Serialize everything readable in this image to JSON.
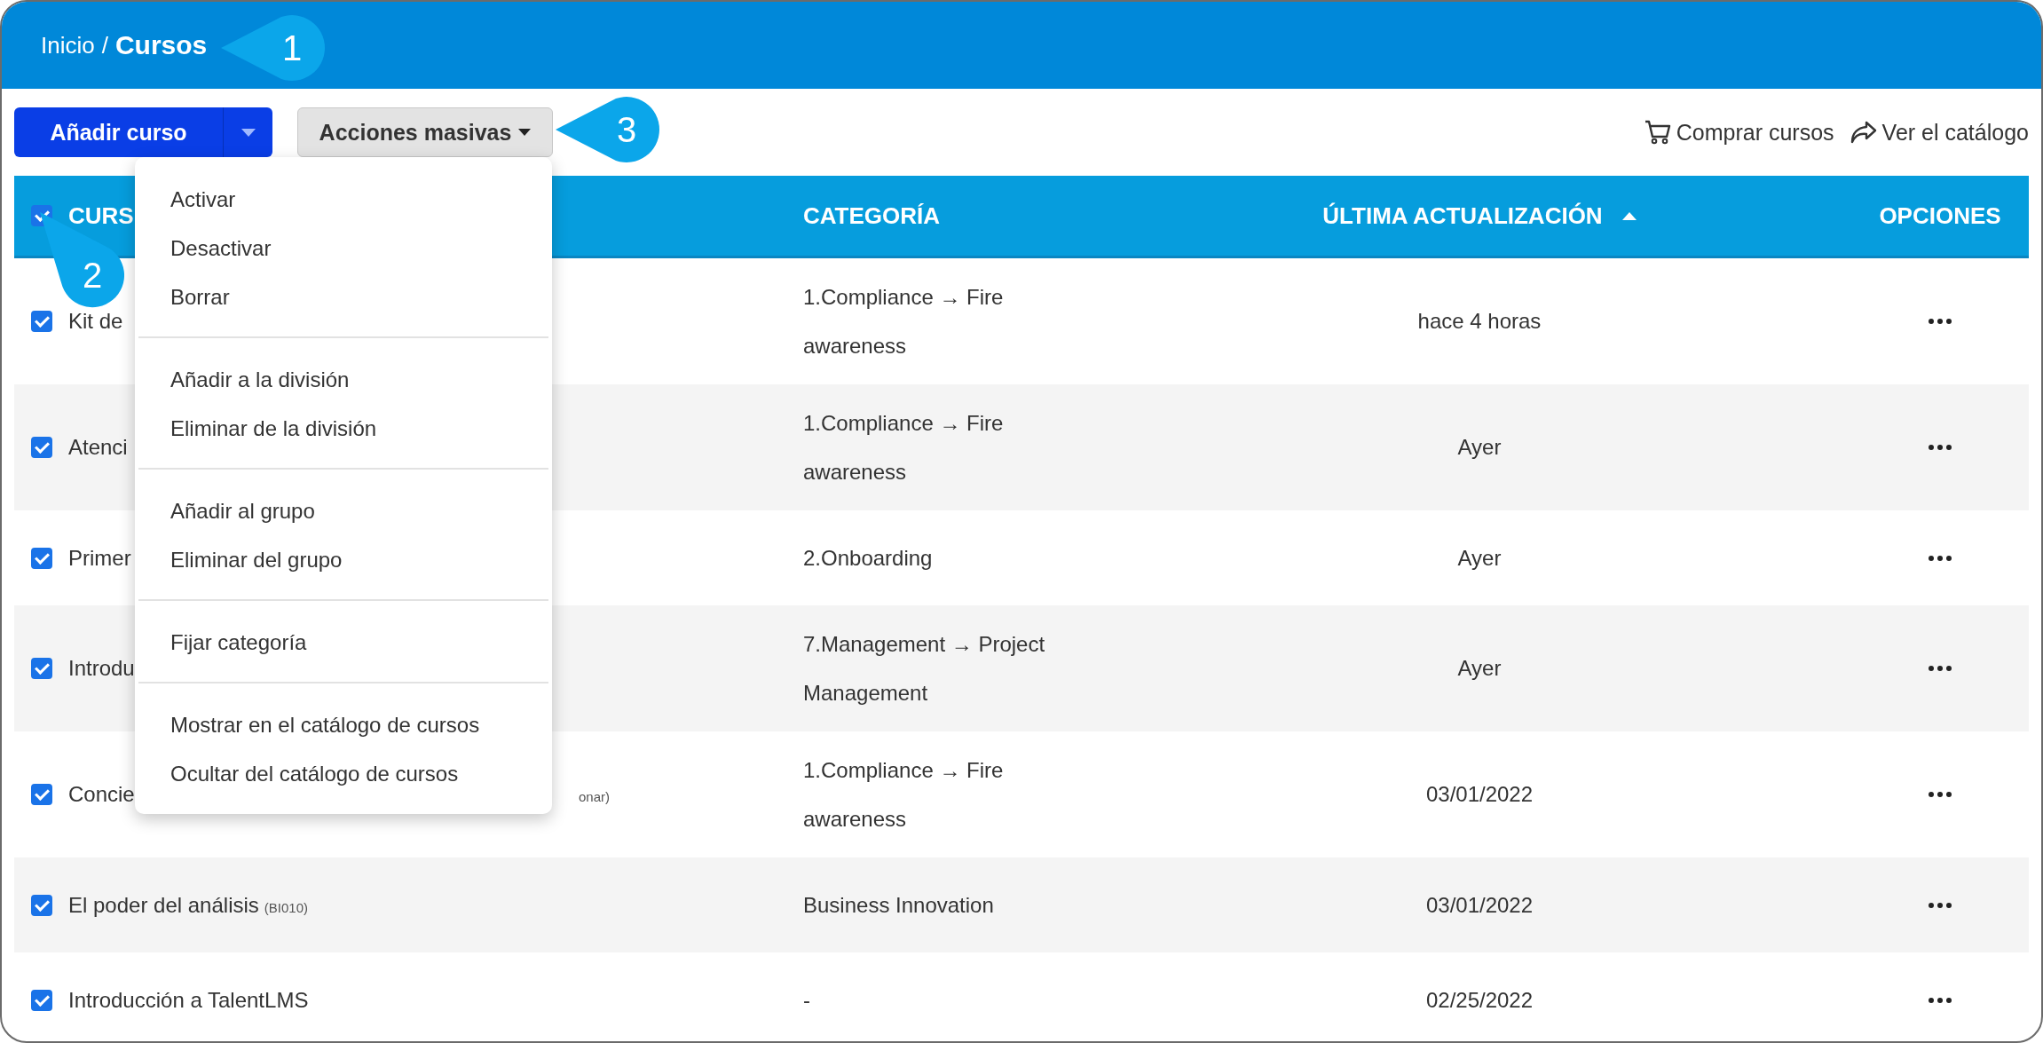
{
  "breadcrumb": [
    {
      "label": "Inicio",
      "current": false,
      "separator": "/"
    },
    {
      "label": "Cursos",
      "current": true
    }
  ],
  "toolbar": {
    "add_button": "Añadir curso",
    "bulk_button": "Acciones masivas",
    "links": [
      {
        "label": "Comprar cursos",
        "kind": "cart"
      },
      {
        "label": "Ver el catálogo",
        "kind": "share"
      }
    ]
  },
  "bulk_menu": {
    "groups": [
      {
        "items": [
          "Activar",
          "Desactivar",
          "Borrar"
        ]
      },
      {
        "items": [
          "Añadir a la división",
          "Eliminar de la división"
        ]
      },
      {
        "items": [
          "Añadir al grupo",
          "Eliminar del grupo"
        ]
      },
      {
        "items": [
          "Fijar categoría"
        ]
      },
      {
        "items": [
          "Mostrar en el catálogo de cursos",
          "Ocultar del catálogo de cursos"
        ]
      }
    ]
  },
  "table": {
    "select_all": {
      "checked": true
    },
    "columns": [
      {
        "label": "CURS"
      },
      {
        "label": "CATEGORÍA",
        "sorted": false
      },
      {
        "label": "ÚLTIMA ACTUALIZACIÓN",
        "sorted": true
      },
      {
        "label": "OPCIONES",
        "sorted": false
      }
    ],
    "rows": [
      {
        "checked": true,
        "course": {
          "kind": "plain",
          "name": "Kit de"
        },
        "category": "1.Compliance → Fire awareness",
        "updated": "hace 4 horas"
      },
      {
        "checked": true,
        "course": {
          "kind": "plain",
          "name": "Atenci"
        },
        "category": "1.Compliance → Fire awareness",
        "updated": "Ayer"
      },
      {
        "checked": true,
        "course": {
          "kind": "plain",
          "name": "Primer"
        },
        "category": "2.Onboarding",
        "updated": "Ayer"
      },
      {
        "checked": true,
        "course": {
          "kind": "plain",
          "name": "Introdu"
        },
        "category": "7.Management → Project Management",
        "updated": "Ayer"
      },
      {
        "checked": true,
        "course": {
          "kind": "partly_hidden",
          "name": "Concie",
          "code": "onar)"
        },
        "category": "1.Compliance → Fire awareness",
        "updated": "03/01/2022"
      },
      {
        "checked": true,
        "course": {
          "kind": "plain",
          "name": "El poder del análisis",
          "code": "(BI010)"
        },
        "category": "Business Innovation",
        "updated": "03/01/2022"
      },
      {
        "checked": true,
        "course": {
          "kind": "plain",
          "name": "Introducción a TalentLMS"
        },
        "category": "-",
        "updated": "02/25/2022"
      }
    ]
  },
  "callouts": [
    {
      "number": "1",
      "kind": "left"
    },
    {
      "number": "2",
      "kind": "up-left"
    },
    {
      "number": "3",
      "kind": "left"
    }
  ]
}
